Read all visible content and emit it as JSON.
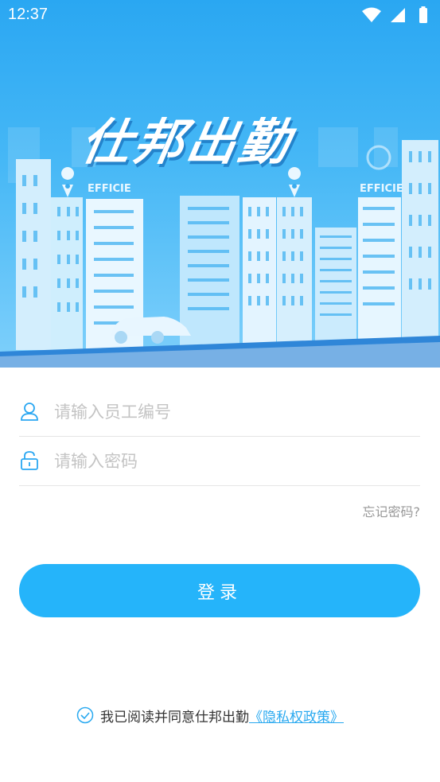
{
  "status_bar": {
    "time": "12:37"
  },
  "brand": {
    "app_name": "仕邦出勤",
    "building_label_1": "EFFICIE",
    "building_label_2": "EFFICIE"
  },
  "login": {
    "employee_id_placeholder": "请输入员工编号",
    "password_placeholder": "请输入密码",
    "forgot_password": "忘记密码?",
    "submit_label": "登录"
  },
  "agreement": {
    "text": "我已阅读并同意仕邦出勤",
    "policy_link": "《隐私权政策》"
  },
  "colors": {
    "primary": "#25b4fa",
    "hero_top": "#2aa7f2",
    "link": "#29a9f0"
  },
  "icons": [
    "wifi-icon",
    "signal-icon",
    "battery-icon",
    "user-icon",
    "lock-icon",
    "check-circle-icon",
    "location-pin-icon"
  ]
}
